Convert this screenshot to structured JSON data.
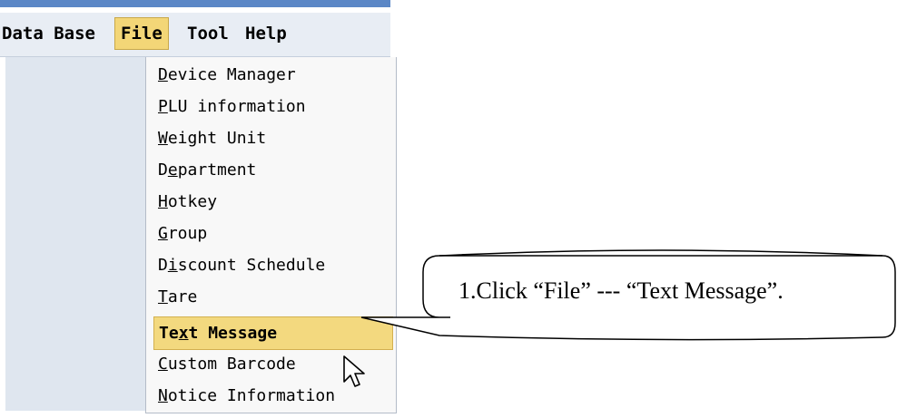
{
  "menubar": {
    "items": [
      {
        "label": "Data Base"
      },
      {
        "label": "File"
      },
      {
        "label": "Tool"
      },
      {
        "label": "Help"
      }
    ]
  },
  "file_menu": {
    "items": [
      {
        "pre": "",
        "u": "D",
        "post": "evice Manager"
      },
      {
        "pre": "",
        "u": "P",
        "post": "LU information"
      },
      {
        "pre": "",
        "u": "W",
        "post": "eight Unit"
      },
      {
        "pre": "D",
        "u": "e",
        "post": "partment"
      },
      {
        "pre": "",
        "u": "H",
        "post": "otkey"
      },
      {
        "pre": "",
        "u": "G",
        "post": "roup"
      },
      {
        "pre": "D",
        "u": "i",
        "post": "scount Schedule"
      },
      {
        "pre": "",
        "u": "T",
        "post": "are"
      },
      {
        "pre": "Te",
        "u": "x",
        "post": "t Message"
      },
      {
        "pre": "",
        "u": "C",
        "post": "ustom Barcode"
      },
      {
        "pre": "",
        "u": "N",
        "post": "otice Information"
      }
    ],
    "highlighted_index": 8
  },
  "callout": {
    "text": "1.Click “File” --- “Text Message”."
  },
  "colors": {
    "highlight": "#f3d97f",
    "menubar_bg": "#e8edf4",
    "title_strip": "#5b87c6"
  }
}
